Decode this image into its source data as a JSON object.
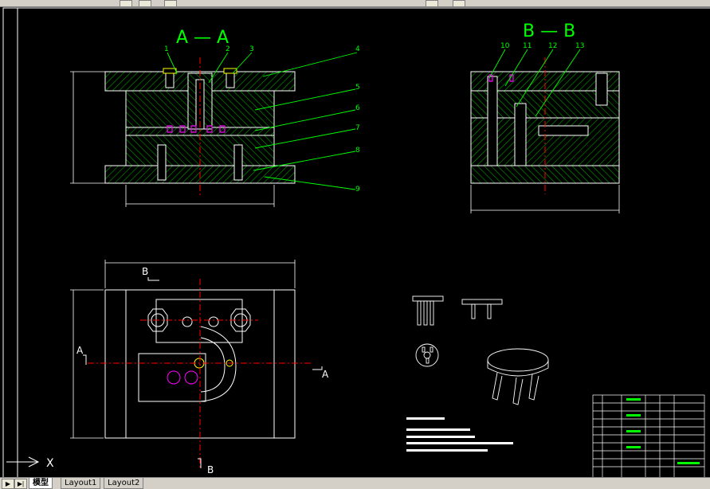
{
  "drawing": {
    "section_aa_title": "A — A",
    "section_bb_title": "B — B",
    "part_callouts_aa": [
      "1",
      "2",
      "3",
      "4",
      "5",
      "6",
      "7",
      "8",
      "9"
    ],
    "part_callouts_bb": [
      "10",
      "11",
      "12",
      "13"
    ],
    "section_marker_a": "A",
    "section_marker_b": "B",
    "ucs_x_label": "X"
  },
  "tabs": {
    "model": "模型",
    "layout1": "Layout1",
    "layout2": "Layout2"
  },
  "colors": {
    "background": "#000000",
    "line_white": "#ffffff",
    "line_green": "#00ff00",
    "center_red": "#ff0000",
    "hatch_green": "#00ff00",
    "detail_magenta": "#ff00ff",
    "detail_yellow": "#ffff00"
  }
}
